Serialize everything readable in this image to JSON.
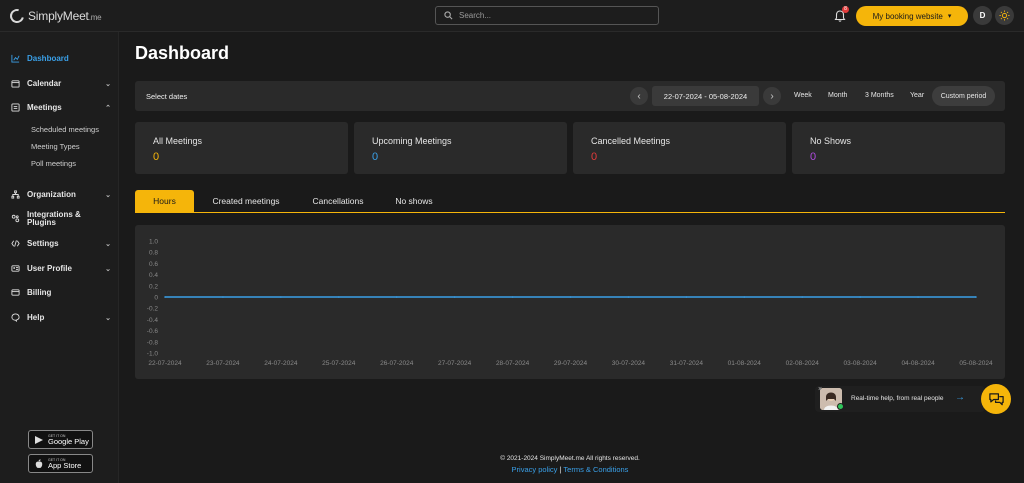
{
  "app": {
    "logo_text": "SimplyMeet",
    "logo_suffix": ".me"
  },
  "topbar": {
    "search_placeholder": "Search...",
    "notification_count": "8",
    "booking_label": "My booking website",
    "avatar_initial": "D"
  },
  "sidebar": {
    "items": [
      {
        "label": "Dashboard",
        "icon": "chart-icon",
        "active": true
      },
      {
        "label": "Calendar",
        "icon": "calendar-icon"
      },
      {
        "label": "Meetings",
        "icon": "meetings-icon"
      },
      {
        "label": "Organization",
        "icon": "organization-icon"
      },
      {
        "label": "Integrations & Plugins",
        "icon": "integrations-icon"
      },
      {
        "label": "Settings",
        "icon": "code-icon"
      },
      {
        "label": "User Profile",
        "icon": "user-card-icon"
      },
      {
        "label": "Billing",
        "icon": "billing-icon"
      },
      {
        "label": "Help",
        "icon": "help-icon"
      }
    ],
    "meetings_sub": [
      "Scheduled meetings",
      "Meeting Types",
      "Poll meetings"
    ],
    "integrations_line1": "Integrations &",
    "integrations_line2": "Plugins",
    "google_play_small": "GET IT ON",
    "google_play": "Google Play",
    "app_store_small": "GET IT ON",
    "app_store": "App Store"
  },
  "main": {
    "title": "Dashboard",
    "select_dates": "Select dates",
    "date_range": "22-07-2024 - 05-08-2024",
    "periods": [
      "Week",
      "Month",
      "3 Months",
      "Year"
    ],
    "active_period": "Custom period",
    "cards": [
      {
        "label": "All Meetings",
        "value": "0",
        "color": "#f5b50a"
      },
      {
        "label": "Upcoming Meetings",
        "value": "0",
        "color": "#3aa0e8"
      },
      {
        "label": "Cancelled Meetings",
        "value": "0",
        "color": "#e23b3b"
      },
      {
        "label": "No Shows",
        "value": "0",
        "color": "#b04be0"
      }
    ],
    "tabs": [
      "Hours",
      "Created meetings",
      "Cancellations",
      "No shows"
    ],
    "active_tab": "Hours"
  },
  "chart_data": {
    "type": "line",
    "x": [
      "22-07-2024",
      "23-07-2024",
      "24-07-2024",
      "25-07-2024",
      "26-07-2024",
      "27-07-2024",
      "28-07-2024",
      "29-07-2024",
      "30-07-2024",
      "31-07-2024",
      "01-08-2024",
      "02-08-2024",
      "03-08-2024",
      "04-08-2024",
      "05-08-2024"
    ],
    "y_ticks": [
      "1.0",
      "0.8",
      "0.6",
      "0.4",
      "0.2",
      "0",
      "-0.2",
      "-0.4",
      "-0.6",
      "-0.8",
      "-1.0"
    ],
    "series": [
      {
        "values": [
          0,
          0,
          0,
          0,
          0,
          0,
          0,
          0,
          0,
          0,
          0,
          0,
          0,
          0,
          0
        ],
        "color": "#3aa0e8"
      }
    ],
    "ylim": [
      -1,
      1
    ],
    "grid": false
  },
  "chat": {
    "text": "Real-time help, from real people"
  },
  "footer": {
    "copyright": "© 2021-2024 SimplyMeet.me All rights reserved.",
    "privacy": "Privacy policy",
    "separator": "|",
    "terms": "Terms & Conditions"
  },
  "colors": {
    "accent": "#f5b50a",
    "link": "#3aa0e8"
  }
}
